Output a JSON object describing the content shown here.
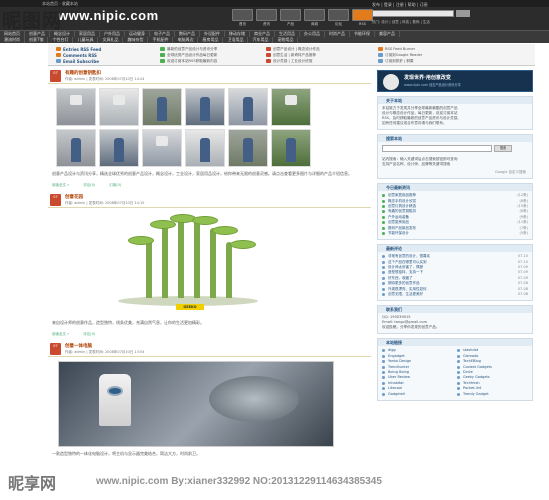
{
  "header": {
    "site_small": "本站首页 · 收藏本站",
    "logo_text": "www.nipic.com",
    "icon_labels": [
      "首页",
      "资讯",
      "产品",
      "商城",
      "论坛",
      "RSS"
    ],
    "right_text": "发布 | 登录 | 注册 | 帮助 | 订阅",
    "right_row": "热门: 设计 | 创意 | 科技 | 数码 | 生活"
  },
  "nav": {
    "row1": [
      "网站首页",
      "创意产品",
      "概念设计",
      "家居用品",
      "户外用品",
      "运动健身",
      "电子产品",
      "数码产品",
      "外设配件",
      "移动存储",
      "商业产品",
      "生活用品",
      "办公用品",
      "时尚产品",
      "节能环保",
      "美容产品"
    ],
    "row2": [
      "潮流时尚",
      "创意T恤",
      "个性台灯",
      "儿童玩具",
      "文具礼品",
      "趣味杂货",
      "手机配件",
      "电脑周边",
      "厨房用品",
      "卫浴用品",
      "汽车用品",
      "宠物用品"
    ]
  },
  "linkbar": {
    "col1": [
      {
        "label": "Entries RSS Feed",
        "style": "main",
        "color": "#e27b1b"
      },
      {
        "label": "Comments RSS",
        "style": "main",
        "color": "#e27b1b"
      },
      {
        "label": "Email Subscribe",
        "style": "main",
        "color": "#6a9cc9"
      }
    ],
    "col2": [
      {
        "label": "最新的创意产品设计与资讯分享",
        "style": "sub",
        "color": "#4caf50"
      },
      {
        "label": "全球优秀产品设计作品每日更新",
        "style": "sub",
        "color": "#4caf50"
      },
      {
        "label": "欢迎订阅本站RSS获取最新内容",
        "style": "sub",
        "color": "#4caf50"
      }
    ],
    "col3": [
      {
        "label": "创意产品设计 | 概念设计作品",
        "style": "sub",
        "color": "#c94a2f"
      },
      {
        "label": "创意生活 | 新奇特产品推荐",
        "style": "sub",
        "color": "#c94a2f"
      },
      {
        "label": "设计灵感 | 工业设计欣赏",
        "style": "sub",
        "color": "#c94a2f"
      }
    ],
    "col4": [
      {
        "label": "RSS Feed Burner",
        "style": "sub",
        "color": "#e27b1b"
      },
      {
        "label": "订阅到Google Reader",
        "style": "sub",
        "color": "#6a9cc9"
      },
      {
        "label": "订阅到抓虾 | 鲜果",
        "style": "sub",
        "color": "#6a9cc9"
      }
    ]
  },
  "posts": [
    {
      "day": "07",
      "title": "有趣的创意钥匙扣",
      "meta": "作者: admin | 发表时间: 2008年07月10日 14:24",
      "text": "创意产品设计与资讯分享，精选全球优秀的创意产品设计，概念设计，工业设计，家居用品设计，给你带来无限的创意灵感。请点击查看更多图片与详细的产品介绍信息。",
      "foot": [
        "阅读全文 »",
        "评论(0)",
        "引用(0)"
      ]
    },
    {
      "day": "07",
      "title": "创意花园",
      "meta": "作者: admin | 发表时间: 2008年07月10日 14:15",
      "text": "来自设计师的创意作品，造型独特，线条优美，充满自然气息，让你的生活更加精彩。",
      "foot": [
        "阅读全文 »",
        "评论(0)"
      ],
      "badge": "GEEKO"
    },
    {
      "day": "07",
      "title": "创意一体电脑",
      "meta": "作者: admin | 发表时间: 2008年07月10日 13:54",
      "text": "一款造型独特的一体化电脑设计，将主机与显示器完美结合，简洁大方，时尚前卫。"
    }
  ],
  "sidebar": {
    "promo_title": "发现世界·用创意改变",
    "promo_sub": "www.nipic.com 创意产品设计资讯分享",
    "about_title": "关于本站",
    "about_lines": [
      "本站致力于发现并分享全球最新最酷的创意产品",
      "设计与概念设计作品，每日更新，欢迎订阅本站",
      "RSS，及时获取最新的创意产品资讯与设计灵感。",
      "如有任何建议或合作意向请与我们联系。"
    ],
    "search_title": "搜索本站",
    "search_btn": "搜索",
    "search_lines": [
      "站内搜索：输入关键词后点击搜索按钮即可查询",
      "支持产品名称、设计师、品牌等关键词搜索"
    ],
    "google_label": "Google 自定义搜索",
    "hot_title": "今日最新资讯",
    "hot_items": [
      {
        "label": "创意家居用品推荐",
        "count": "(12条)"
      },
      {
        "label": "概念手机设计欣赏",
        "count": "(8条)"
      },
      {
        "label": "创意灯具设计精选",
        "count": "(15条)"
      },
      {
        "label": "有趣的创意钥匙扣",
        "count": "(6条)"
      },
      {
        "label": "户外运动装备",
        "count": "(9条)"
      },
      {
        "label": "创意厨房用品",
        "count": "(11条)"
      },
      {
        "label": "数码产品新品发布",
        "count": "(7条)"
      },
      {
        "label": "节能环保设计",
        "count": "(5条)"
      }
    ],
    "recent_title": "最新评论",
    "recent_items": [
      {
        "label": "非常有创意的设计，很喜欢",
        "count": "07-10"
      },
      {
        "label": "这个产品在哪里可以买到",
        "count": "07-10"
      },
      {
        "label": "设计师太厉害了，佩服",
        "count": "07-09"
      },
      {
        "label": "造型很独特，支持一下",
        "count": "07-09"
      },
      {
        "label": "好东西，收藏了",
        "count": "07-09"
      },
      {
        "label": "期待更多的创意作品",
        "count": "07-08"
      },
      {
        "label": "外观很漂亮，实用性如何",
        "count": "07-08"
      },
      {
        "label": "创意无限，生活更美好",
        "count": "07-08"
      }
    ],
    "contact_title": "联系我们",
    "contact_lines": [
      "QQ: 190039015",
      "Email: tango@gmail.com",
      "欢迎投稿，分享你发现的创意产品。"
    ],
    "friends_title": "本站链接",
    "friends": [
      "digg",
      "stashdot",
      "Engadget",
      "Gizmodo",
      "Yanko Design",
      "TechEBlog",
      "Trendhunter",
      "Coolest Gadgets",
      "Boing Boing",
      "Dvice",
      "Uber Review",
      "Geeky Gadgets",
      "Inhabitat",
      "Techfresh",
      "Likecool",
      "Pocket-lint",
      "Gadgetell",
      "Trendy Gadget"
    ]
  },
  "watermark": {
    "top": "昵图网",
    "bottom": "昵享网",
    "url": "www.nipic.com  By:xianer332992  NO:20131229114634385345"
  }
}
